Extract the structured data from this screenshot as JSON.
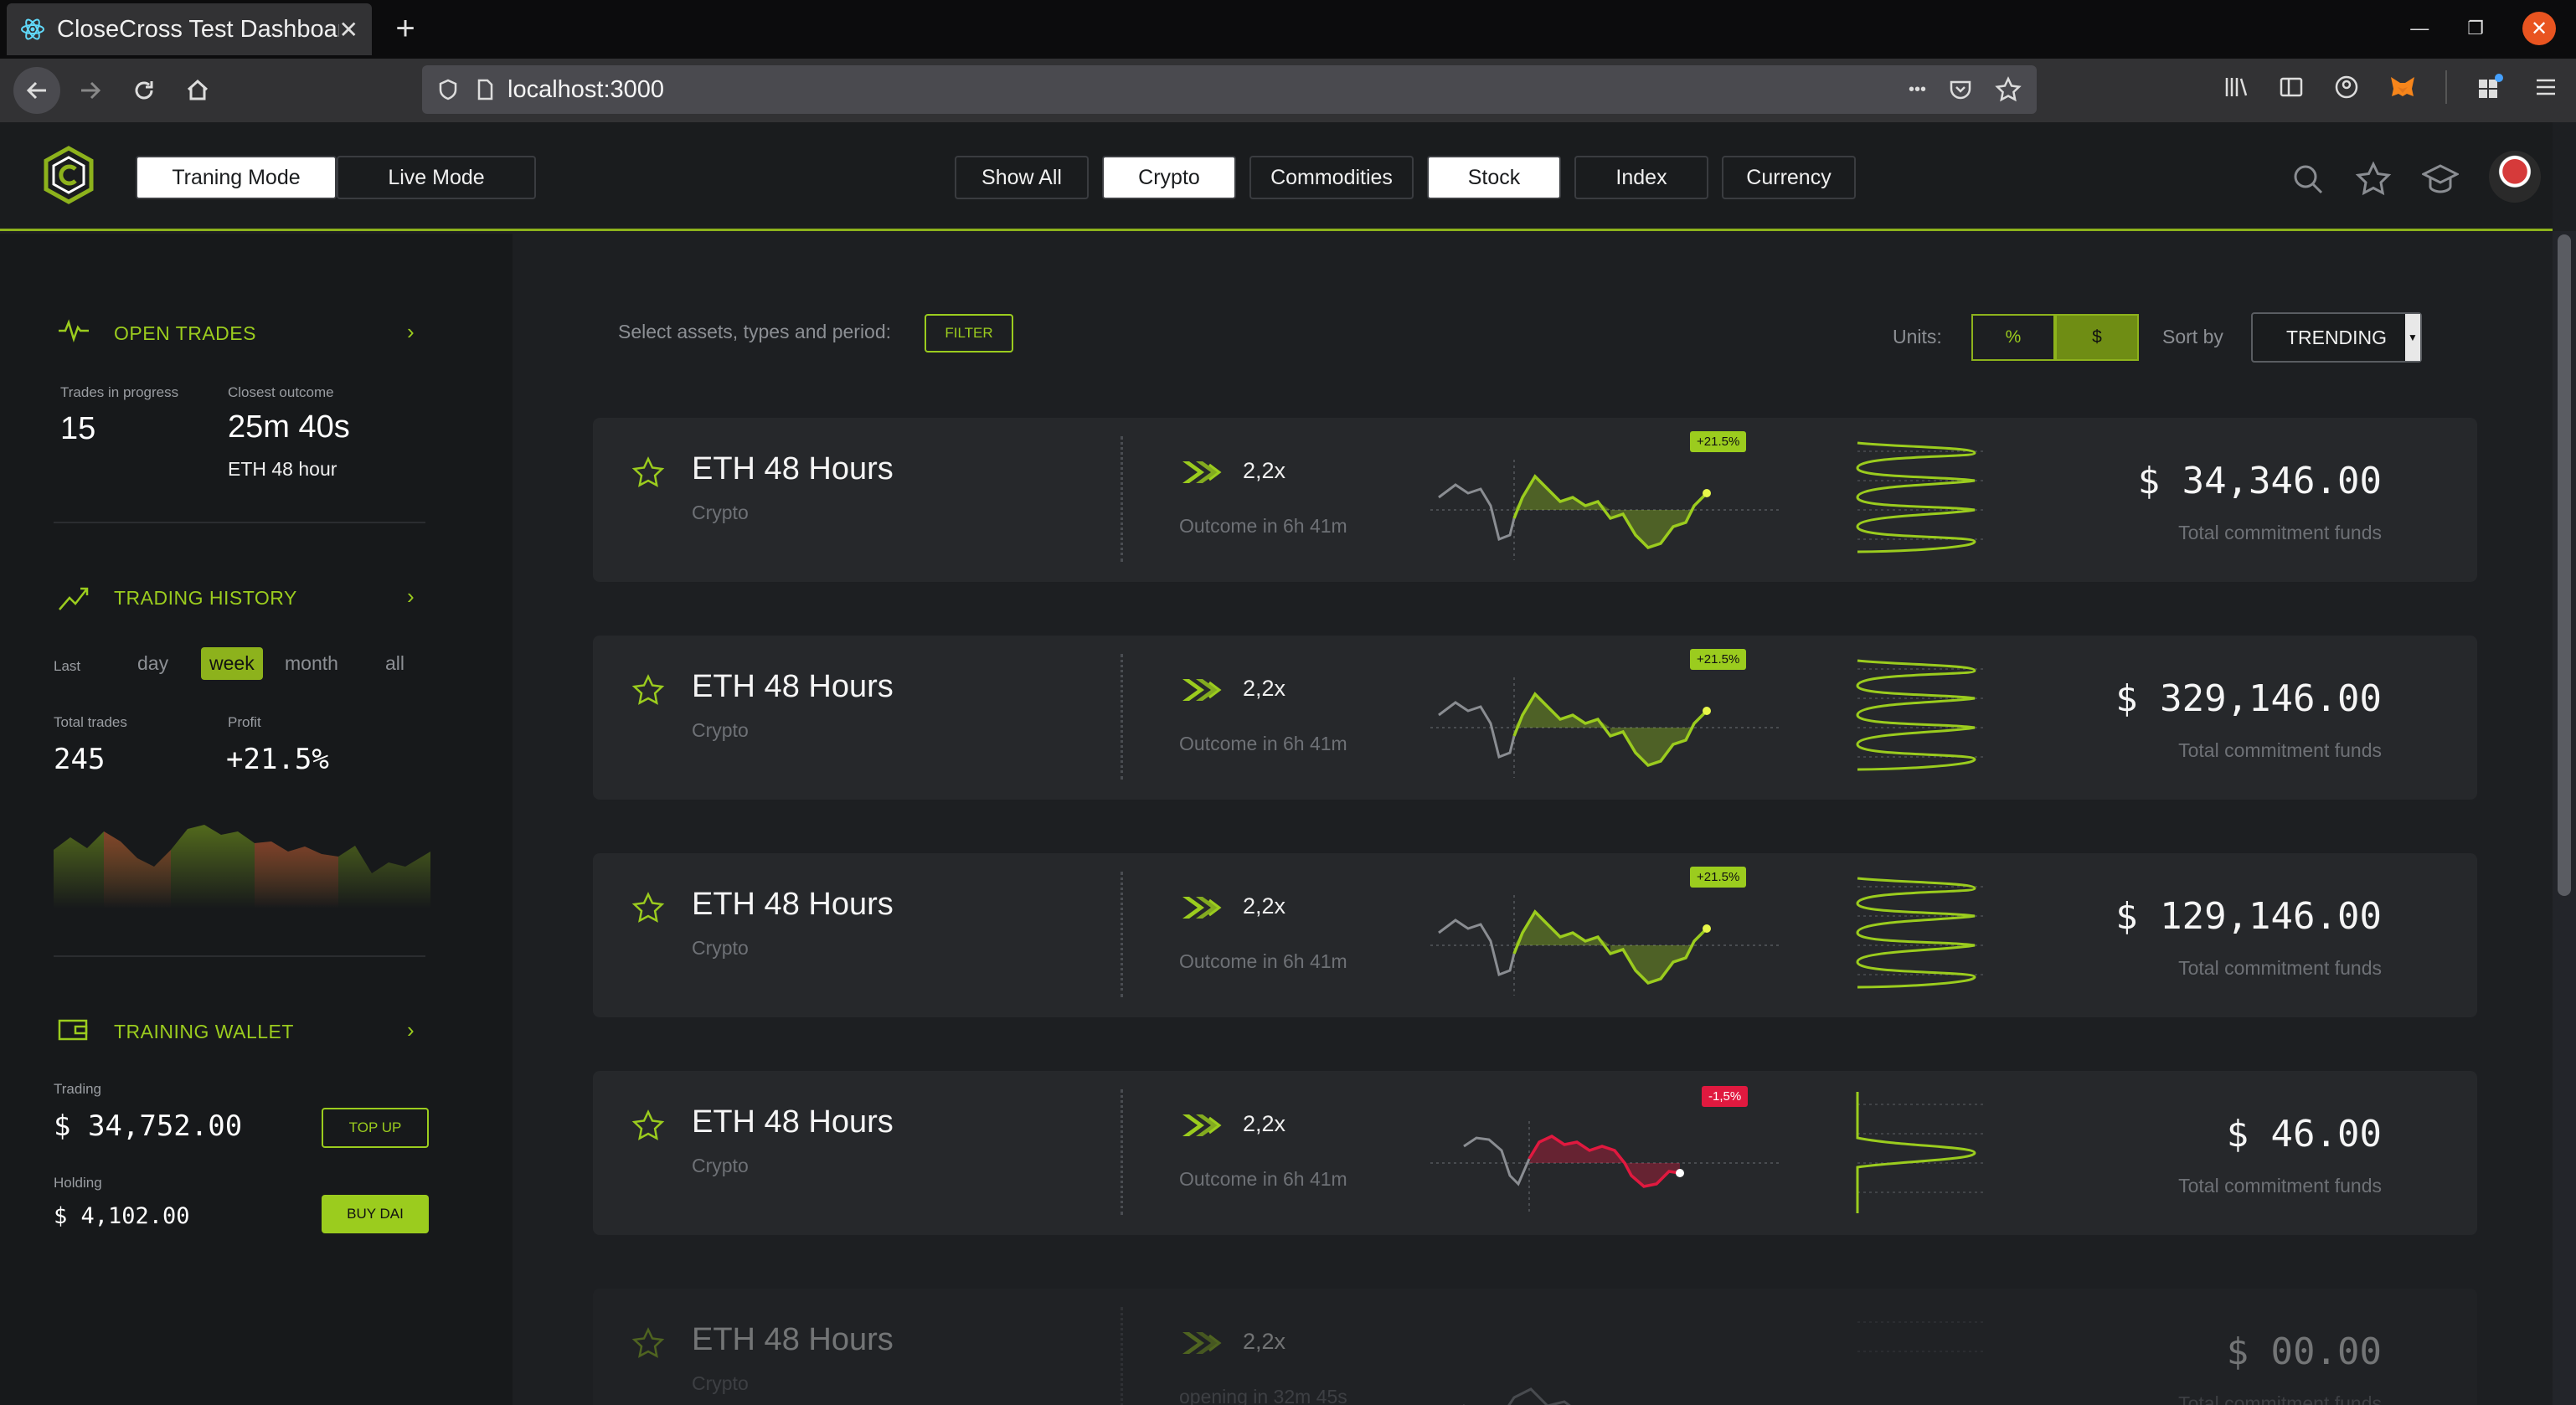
{
  "browser": {
    "tab_title": "CloseCross Test Dashboard",
    "new_tab": "+",
    "url": "localhost:3000",
    "url_more": "•••"
  },
  "header": {
    "modes": [
      "Traning Mode",
      "Live Mode"
    ],
    "active_mode": "Traning Mode",
    "categories": [
      "Show All",
      "Crypto",
      "Commodities",
      "Stock",
      "Index",
      "Currency"
    ],
    "active_categories": [
      "Crypto",
      "Stock"
    ]
  },
  "sidebar": {
    "open_trades": {
      "title": "OPEN TRADES",
      "in_progress_label": "Trades in progress",
      "in_progress_value": "15",
      "closest_label": "Closest outcome",
      "closest_value": "25m 40s",
      "closest_asset": "ETH 48 hour"
    },
    "trading_history": {
      "title": "TRADING HISTORY",
      "last_label": "Last",
      "periods": [
        "day",
        "week",
        "month",
        "all"
      ],
      "active_period": "week",
      "total_label": "Total trades",
      "total_value": "245",
      "profit_label": "Profit",
      "profit_value": "+21.5%"
    },
    "wallet": {
      "title": "TRAINING WALLET",
      "trading_label": "Trading",
      "trading_value": "$ 34,752.00",
      "top_up": "TOP UP",
      "holding_label": "Holding",
      "holding_value": "$ 4,102.00",
      "buy": "BUY DAI"
    }
  },
  "main": {
    "filter_label": "Select assets, types and period:",
    "filter_button": "FILTER",
    "units_label": "Units:",
    "unit_options": [
      "%",
      "$"
    ],
    "active_unit": "$",
    "sort_label": "Sort by",
    "sort_value": "TRENDING",
    "cards": [
      {
        "name": "ETH 48 Hours",
        "type": "Crypto",
        "leverage": "2,2x",
        "outcome": "Outcome in 6h 41m",
        "badge": "+21.5%",
        "trend": "up",
        "amount": "$ 34,346.00",
        "amount_label": "Total commitment funds"
      },
      {
        "name": "ETH 48 Hours",
        "type": "Crypto",
        "leverage": "2,2x",
        "outcome": "Outcome in 6h 41m",
        "badge": "+21.5%",
        "trend": "up",
        "amount": "$ 329,146.00",
        "amount_label": "Total commitment funds"
      },
      {
        "name": "ETH 48 Hours",
        "type": "Crypto",
        "leverage": "2,2x",
        "outcome": "Outcome in 6h 41m",
        "badge": "+21.5%",
        "trend": "up",
        "amount": "$ 129,146.00",
        "amount_label": "Total commitment funds"
      },
      {
        "name": "ETH 48 Hours",
        "type": "Crypto",
        "leverage": "2,2x",
        "outcome": "Outcome in 6h 41m",
        "badge": "-1,5%",
        "trend": "down",
        "amount": "$ 46.00",
        "amount_label": "Total commitment funds"
      },
      {
        "name": "ETH 48 Hours",
        "type": "Crypto",
        "leverage": "2,2x",
        "outcome": "opening in 32m 45s",
        "badge": "",
        "trend": "none",
        "amount": "$ 00.00",
        "amount_label": "Total commitment funds"
      }
    ]
  },
  "colors": {
    "accent": "#9bcc1e",
    "accent_dark": "#8db21c",
    "negative": "#e0193f",
    "card_bg": "#26282b"
  }
}
